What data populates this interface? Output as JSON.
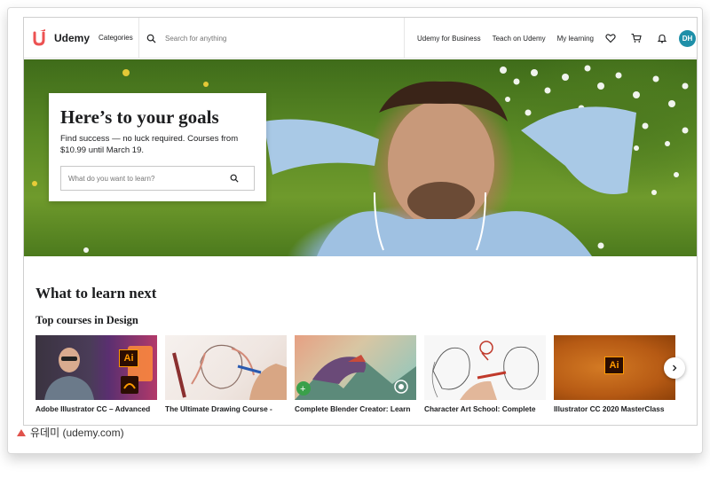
{
  "header": {
    "logo_text": "Udemy",
    "categories_label": "Categories",
    "search_placeholder": "Search for anything",
    "business_link": "Udemy for Business",
    "teach_link": "Teach on Udemy",
    "my_learning_link": "My learning",
    "avatar_initials": "DH",
    "icons": [
      "search-icon",
      "heart-icon",
      "cart-icon",
      "bell-icon"
    ]
  },
  "hero": {
    "title": "Here’s to your goals",
    "subtitle": "Find success — no luck required. Courses from $10.99 until March 19.",
    "search_placeholder": "What do you want to learn?"
  },
  "main": {
    "section_title": "What to learn next",
    "subsection_title": "Top courses in Design",
    "courses": [
      {
        "title": "Adobe Illustrator CC – Advanced"
      },
      {
        "title": "The Ultimate Drawing Course -"
      },
      {
        "title": "Complete Blender Creator: Learn"
      },
      {
        "title": "Character Art School: Complete"
      },
      {
        "title": "Illustrator CC 2020 MasterClass"
      }
    ]
  },
  "caption": "유데미 (udemy.com)",
  "colors": {
    "brand": "#a435f0",
    "logo_red": "#ec5252",
    "avatar_bg": "#1e8fa8",
    "caption_arrow": "#e0524b"
  }
}
